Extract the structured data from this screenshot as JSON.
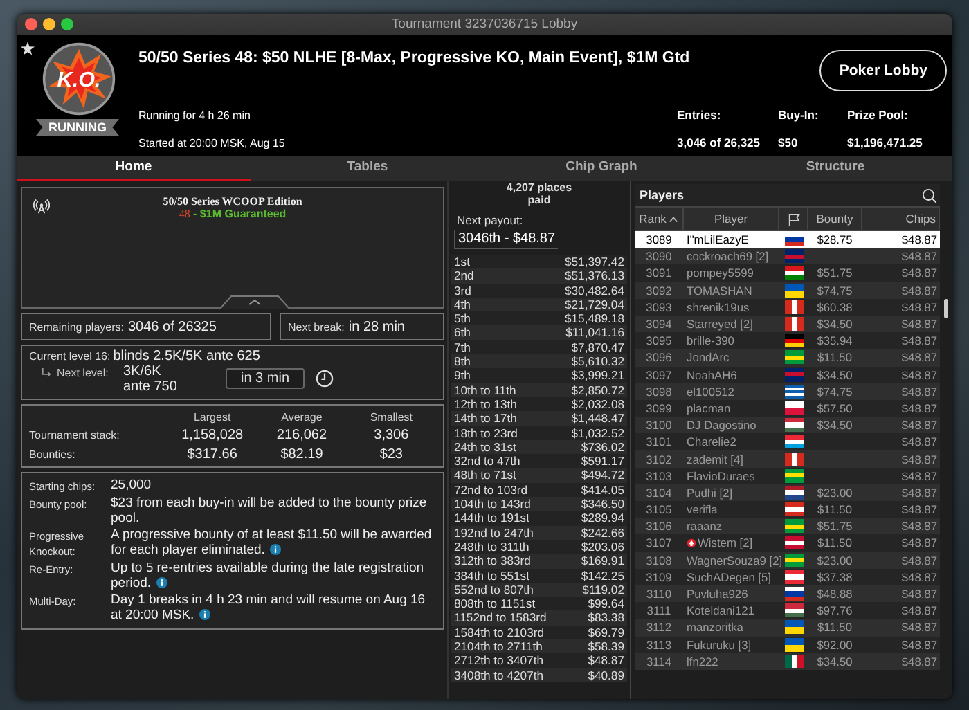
{
  "window": {
    "title": "Tournament 3237036715 Lobby"
  },
  "header": {
    "logo_text": "K.O.",
    "status": "RUNNING",
    "favorite": true,
    "title": "50/50 Series 48: $50 NLHE [8-Max, Progressive KO, Main Event], $1M Gtd",
    "running_for": "Running for 4 h 26 min",
    "started_at": "Started at 20:00 MSK, Aug 15",
    "lobby_button": "Poker Lobby",
    "stats": [
      {
        "label": "Entries:",
        "value": "3,046 of 26,325"
      },
      {
        "label": "Buy-In:",
        "value": "$50"
      },
      {
        "label": "Prize Pool:",
        "value": "$1,196,471.25"
      }
    ]
  },
  "tabs": [
    {
      "label": "Home",
      "selected": true
    },
    {
      "label": "Tables",
      "selected": false
    },
    {
      "label": "Chip Graph",
      "selected": false
    },
    {
      "label": "Structure",
      "selected": false
    }
  ],
  "banner": {
    "title": "50/50 Series WCOOP Edition",
    "number": "48",
    "subtitle": "- $1M Guaranteed"
  },
  "remaining": {
    "label": "Remaining players:",
    "value": "3046 of 26325"
  },
  "next_break": {
    "label": "Next break:",
    "value": "in 28 min"
  },
  "level": {
    "current_label": "Current level 16:",
    "current_value": "blinds 2.5K/5K ante 625",
    "next_label": "Next level:",
    "next_blinds": "3K/6K",
    "next_ante": "ante 750",
    "countdown": "in 3 min"
  },
  "stack_table": {
    "columns": [
      "Largest",
      "Average",
      "Smallest"
    ],
    "rows": [
      {
        "label": "Tournament stack:",
        "values": [
          "1,158,028",
          "216,062",
          "3,306"
        ]
      },
      {
        "label": "Bounties:",
        "values": [
          "$317.66",
          "$82.19",
          "$23"
        ]
      }
    ]
  },
  "info": [
    {
      "label": "Starting chips:",
      "value": "25,000",
      "info": false
    },
    {
      "label": "Bounty pool:",
      "value": "$23 from each buy-in will be added to the bounty prize pool.",
      "info": false
    },
    {
      "label": "Progressive Knockout:",
      "value": "A progressive bounty of at least $11.50 will be awarded for each player eliminated.",
      "info": true
    },
    {
      "label": "Re-Entry:",
      "value": "Up to 5 re-entries available during the late registration period.",
      "info": true
    },
    {
      "label": "Multi-Day:",
      "value": "Day 1 breaks in 4 h 23 min and will resume on Aug 16 at 20:00 MSK.",
      "info": true
    }
  ],
  "payouts": {
    "places": "4,207 places",
    "paid": "paid",
    "next_label": "Next payout:",
    "next_value": "3046th - $48.87",
    "rows": [
      {
        "place": "1st",
        "prize": "$51,397.42"
      },
      {
        "place": "2nd",
        "prize": "$51,376.13"
      },
      {
        "place": "3rd",
        "prize": "$30,482.64"
      },
      {
        "place": "4th",
        "prize": "$21,729.04"
      },
      {
        "place": "5th",
        "prize": "$15,489.18"
      },
      {
        "place": "6th",
        "prize": "$11,041.16"
      },
      {
        "place": "7th",
        "prize": "$7,870.47"
      },
      {
        "place": "8th",
        "prize": "$5,610.32"
      },
      {
        "place": "9th",
        "prize": "$3,999.21"
      },
      {
        "place": "10th to 11th",
        "prize": "$2,850.72"
      },
      {
        "place": "12th to 13th",
        "prize": "$2,032.08"
      },
      {
        "place": "14th to 17th",
        "prize": "$1,448.47"
      },
      {
        "place": "18th to 23rd",
        "prize": "$1,032.52"
      },
      {
        "place": "24th to 31st",
        "prize": "$736.02"
      },
      {
        "place": "32nd to 47th",
        "prize": "$591.17"
      },
      {
        "place": "48th to 71st",
        "prize": "$494.72"
      },
      {
        "place": "72nd to 103rd",
        "prize": "$414.05"
      },
      {
        "place": "104th to 143rd",
        "prize": "$346.50"
      },
      {
        "place": "144th to 191st",
        "prize": "$289.94"
      },
      {
        "place": "192nd to 247th",
        "prize": "$242.66"
      },
      {
        "place": "248th to 311th",
        "prize": "$203.06"
      },
      {
        "place": "312th to 383rd",
        "prize": "$169.91"
      },
      {
        "place": "384th to 551st",
        "prize": "$142.25"
      },
      {
        "place": "552nd to 807th",
        "prize": "$119.02"
      },
      {
        "place": "808th to 1151st",
        "prize": "$99.64"
      },
      {
        "place": "1152nd to 1583rd",
        "prize": "$83.38"
      },
      {
        "place": "1584th to 2103rd",
        "prize": "$69.79"
      },
      {
        "place": "2104th to 2711th",
        "prize": "$58.39"
      },
      {
        "place": "2712th to 3407th",
        "prize": "$48.87"
      },
      {
        "place": "3408th to 4207th",
        "prize": "$40.89"
      }
    ]
  },
  "players": {
    "title": "Players",
    "columns": [
      "Rank",
      "Player",
      "Bounty",
      "Chips"
    ],
    "rows": [
      {
        "rank": "3089",
        "name": "I\"mLilEazyE",
        "flag": [
          {
            "color": "#ffffff"
          },
          {
            "color": "#0039a6"
          },
          {
            "color": "#d52b1e"
          }
        ],
        "flag_vertical": false,
        "bounty": "$28.75",
        "chips": "$48.87",
        "selected": true,
        "marked": false
      },
      {
        "rank": "3090",
        "name": "cockroach69 [2]",
        "flag": [
          {
            "color": "#012169"
          },
          {
            "color": "#c8102e"
          },
          {
            "color": "#012169"
          }
        ],
        "flag_vertical": false,
        "chips": "$48.87",
        "selected": false,
        "marked": false
      },
      {
        "rank": "3091",
        "name": "pompey5599",
        "flag": [
          {
            "color": "#db161b"
          },
          {
            "color": "#ffffff"
          },
          {
            "color": "#008000"
          }
        ],
        "flag_vertical": false,
        "bounty": "$51.75",
        "chips": "$48.87",
        "selected": false,
        "marked": false
      },
      {
        "rank": "3092",
        "name": "TOMASHAN",
        "flag": [
          {
            "color": "#0057b7"
          },
          {
            "color": "#ffd700"
          }
        ],
        "flag_vertical": false,
        "bounty": "$74.75",
        "chips": "$48.87",
        "selected": false,
        "marked": false
      },
      {
        "rank": "3093",
        "name": "shrenik19us",
        "flag": [
          {
            "color": "#d52b1e"
          },
          {
            "color": "#ffffff"
          },
          {
            "color": "#d52b1e"
          }
        ],
        "flag_vertical": true,
        "bounty": "$60.38",
        "chips": "$48.87",
        "selected": false,
        "marked": false
      },
      {
        "rank": "3094",
        "name": "Starreyed [2]",
        "flag": [
          {
            "color": "#d52b1e"
          },
          {
            "color": "#ffffff"
          },
          {
            "color": "#d52b1e"
          }
        ],
        "flag_vertical": true,
        "bounty": "$34.50",
        "chips": "$48.87",
        "selected": false,
        "marked": false
      },
      {
        "rank": "3095",
        "name": "brille-390",
        "flag": [
          {
            "color": "#000000"
          },
          {
            "color": "#dd0000"
          },
          {
            "color": "#ffce00"
          }
        ],
        "flag_vertical": false,
        "bounty": "$35.94",
        "chips": "$48.87",
        "selected": false,
        "marked": false
      },
      {
        "rank": "3096",
        "name": "JondArc",
        "flag": [
          {
            "color": "#009c3b"
          },
          {
            "color": "#ffdf00"
          },
          {
            "color": "#009c3b"
          }
        ],
        "flag_vertical": false,
        "bounty": "$11.50",
        "chips": "$48.87",
        "selected": false,
        "marked": false
      },
      {
        "rank": "3097",
        "name": "NoahAH6",
        "flag": [
          {
            "color": "#012169"
          },
          {
            "color": "#c8102e"
          },
          {
            "color": "#012169"
          }
        ],
        "flag_vertical": false,
        "bounty": "$34.50",
        "chips": "$48.87",
        "selected": false,
        "marked": false
      },
      {
        "rank": "3098",
        "name": "el100512",
        "flag": [
          {
            "color": "#0d5eaf"
          },
          {
            "color": "#ffffff"
          },
          {
            "color": "#0d5eaf"
          },
          {
            "color": "#ffffff"
          },
          {
            "color": "#0d5eaf"
          }
        ],
        "flag_vertical": false,
        "bounty": "$74.75",
        "chips": "$48.87",
        "selected": false,
        "marked": false
      },
      {
        "rank": "3099",
        "name": "placman",
        "flag": [
          {
            "color": "#ffffff"
          },
          {
            "color": "#dc143c"
          }
        ],
        "flag_vertical": false,
        "bounty": "$57.50",
        "chips": "$48.87",
        "selected": false,
        "marked": false
      },
      {
        "rank": "3100",
        "name": "DJ Dagostino",
        "flag": [
          {
            "color": "#cd2a3e"
          },
          {
            "color": "#ffffff"
          },
          {
            "color": "#436f4d"
          }
        ],
        "flag_vertical": false,
        "bounty": "$34.50",
        "chips": "$48.87",
        "selected": false,
        "marked": false
      },
      {
        "rank": "3101",
        "name": "Charelie2",
        "flag": [
          {
            "color": "#ed2939"
          },
          {
            "color": "#ffffff"
          },
          {
            "color": "#00a1de"
          }
        ],
        "flag_vertical": false,
        "chips": "$48.87",
        "selected": false,
        "marked": false
      },
      {
        "rank": "3102",
        "name": "zademit [4]",
        "flag": [
          {
            "color": "#d52b1e"
          },
          {
            "color": "#ffffff"
          },
          {
            "color": "#d52b1e"
          }
        ],
        "flag_vertical": true,
        "chips": "$48.87",
        "selected": false,
        "marked": false
      },
      {
        "rank": "3103",
        "name": "FlavioDuraes",
        "flag": [
          {
            "color": "#009c3b"
          },
          {
            "color": "#ffdf00"
          },
          {
            "color": "#009c3b"
          }
        ],
        "flag_vertical": false,
        "chips": "$48.87",
        "selected": false,
        "marked": false
      },
      {
        "rank": "3104",
        "name": "Pudhi [2]",
        "flag": [
          {
            "color": "#ae1c28"
          },
          {
            "color": "#ffffff"
          },
          {
            "color": "#21468b"
          }
        ],
        "flag_vertical": false,
        "bounty": "$23.00",
        "chips": "$48.87",
        "selected": false,
        "marked": false
      },
      {
        "rank": "3105",
        "name": "verifla",
        "flag": [
          {
            "color": "#d52b1e"
          },
          {
            "color": "#ffffff"
          },
          {
            "color": "#d52b1e"
          }
        ],
        "flag_vertical": false,
        "bounty": "$11.50",
        "chips": "$48.87",
        "selected": false,
        "marked": false
      },
      {
        "rank": "3106",
        "name": "raaanz",
        "flag": [
          {
            "color": "#009c3b"
          },
          {
            "color": "#ffdf00"
          },
          {
            "color": "#009c3b"
          }
        ],
        "flag_vertical": false,
        "bounty": "$51.75",
        "chips": "$48.87",
        "selected": false,
        "marked": false
      },
      {
        "rank": "3107",
        "name": "Wistem [2]",
        "flag": [
          {
            "color": "#c60c30"
          },
          {
            "color": "#ffffff"
          },
          {
            "color": "#c60c30"
          }
        ],
        "flag_vertical": false,
        "bounty": "$11.50",
        "chips": "$48.87",
        "selected": false,
        "marked": true
      },
      {
        "rank": "3108",
        "name": "WagnerSouza9 [2]",
        "flag": [
          {
            "color": "#009c3b"
          },
          {
            "color": "#ffdf00"
          },
          {
            "color": "#009c3b"
          }
        ],
        "flag_vertical": false,
        "bounty": "$23.00",
        "chips": "$48.87",
        "selected": false,
        "marked": false
      },
      {
        "rank": "3109",
        "name": "SuchADegen [5]",
        "flag": [
          {
            "color": "#ed2939"
          },
          {
            "color": "#ffffff"
          },
          {
            "color": "#ed2939"
          }
        ],
        "flag_vertical": false,
        "bounty": "$37.38",
        "chips": "$48.87",
        "selected": false,
        "marked": false
      },
      {
        "rank": "3110",
        "name": "Puvluha926",
        "flag": [
          {
            "color": "#ffffff"
          },
          {
            "color": "#0039a6"
          },
          {
            "color": "#d52b1e"
          }
        ],
        "flag_vertical": false,
        "bounty": "$48.88",
        "chips": "$48.87",
        "selected": false,
        "marked": false
      },
      {
        "rank": "3111",
        "name": "Koteldani121",
        "flag": [
          {
            "color": "#cd2a3e"
          },
          {
            "color": "#ffffff"
          },
          {
            "color": "#436f4d"
          }
        ],
        "flag_vertical": false,
        "bounty": "$97.76",
        "chips": "$48.87",
        "selected": false,
        "marked": false
      },
      {
        "rank": "3112",
        "name": "manzoritka",
        "flag": [
          {
            "color": "#0057b7"
          },
          {
            "color": "#ffd700"
          }
        ],
        "flag_vertical": false,
        "bounty": "$11.50",
        "chips": "$48.87",
        "selected": false,
        "marked": false
      },
      {
        "rank": "3113",
        "name": "Fukuruku [3]",
        "flag": [
          {
            "color": "#0057b7"
          },
          {
            "color": "#ffd700"
          }
        ],
        "flag_vertical": false,
        "bounty": "$92.00",
        "chips": "$48.87",
        "selected": false,
        "marked": false
      },
      {
        "rank": "3114",
        "name": "lfn222",
        "flag": [
          {
            "color": "#006847"
          },
          {
            "color": "#ffffff"
          },
          {
            "color": "#ce1126"
          }
        ],
        "flag_vertical": true,
        "bounty": "$34.50",
        "chips": "$48.87",
        "selected": false,
        "marked": false
      }
    ]
  }
}
